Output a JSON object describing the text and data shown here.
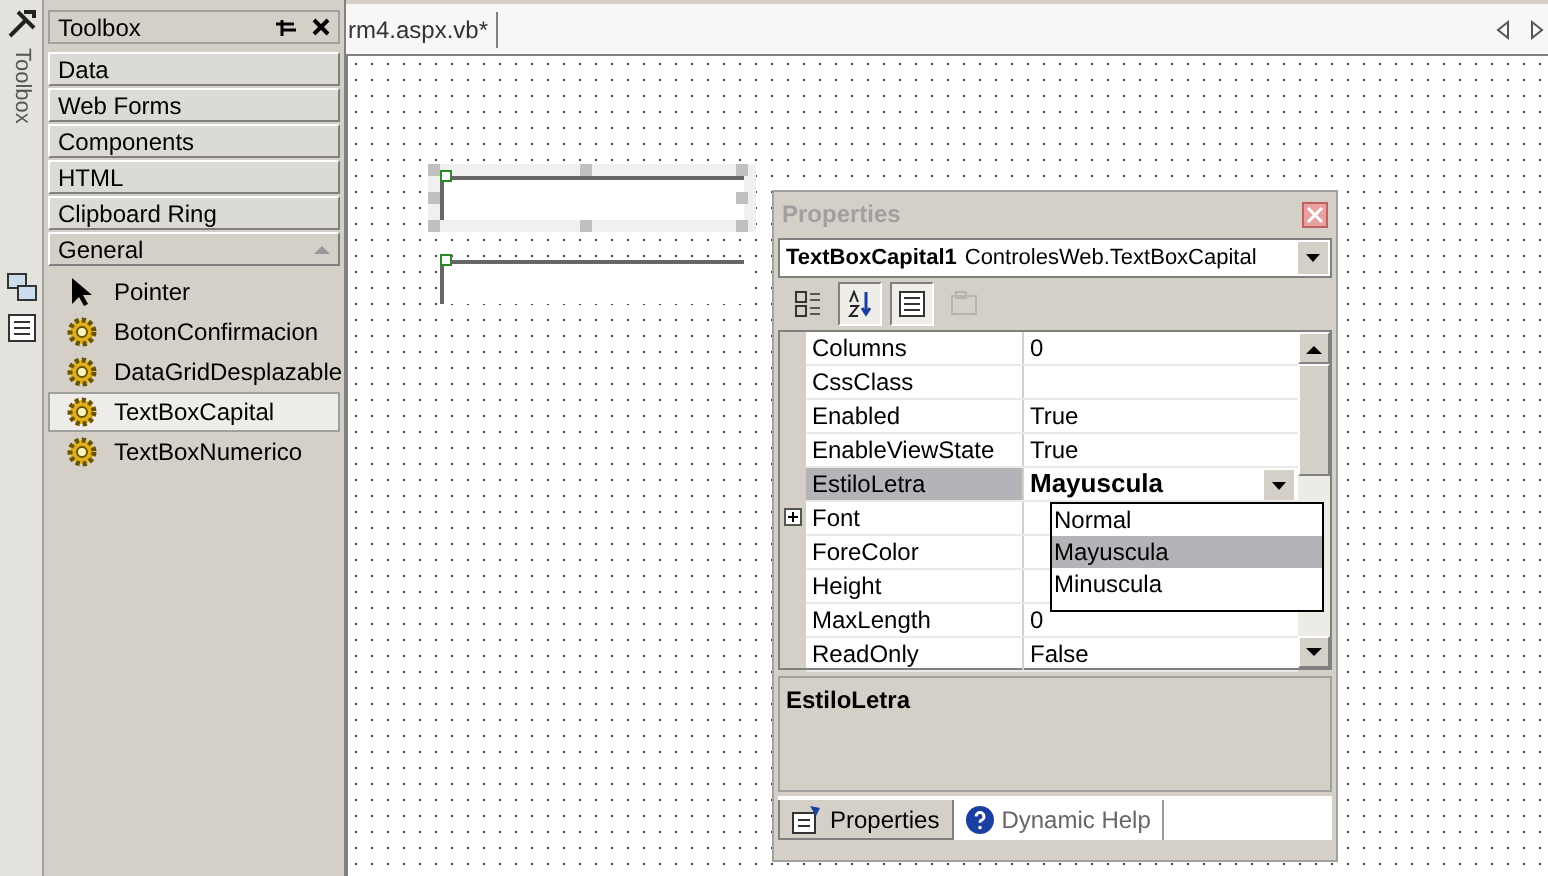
{
  "toolbox": {
    "side_tab": "Toolbox",
    "title": "Toolbox",
    "categories": [
      {
        "label": "Data",
        "expanded": false
      },
      {
        "label": "Web Forms",
        "expanded": false
      },
      {
        "label": "Components",
        "expanded": false
      },
      {
        "label": "HTML",
        "expanded": false
      },
      {
        "label": "Clipboard Ring",
        "expanded": false
      },
      {
        "label": "General",
        "expanded": true
      }
    ],
    "items": [
      {
        "label": "Pointer",
        "kind": "pointer",
        "selected": false
      },
      {
        "label": "BotonConfirmacion",
        "kind": "component",
        "selected": false
      },
      {
        "label": "DataGridDesplazable",
        "kind": "component",
        "selected": false
      },
      {
        "label": "TextBoxCapital",
        "kind": "component",
        "selected": true
      },
      {
        "label": "TextBoxNumerico",
        "kind": "component",
        "selected": false
      }
    ]
  },
  "document_tab": {
    "title": "rm4.aspx.vb*"
  },
  "designer": {
    "textboxes": [
      {
        "selected": true
      },
      {
        "selected": false
      }
    ]
  },
  "properties": {
    "title": "Properties",
    "object_name": "TextBoxCapital1",
    "object_type": "ControlesWeb.TextBoxCapital",
    "toolbar": [
      {
        "kind": "categorized",
        "pressed": false,
        "disabled": false
      },
      {
        "kind": "alphabetical",
        "pressed": true,
        "disabled": false
      },
      {
        "kind": "properties",
        "pressed": true,
        "disabled": false
      },
      {
        "kind": "pages",
        "pressed": false,
        "disabled": true
      }
    ],
    "rows": [
      {
        "name": "Columns",
        "value": "0",
        "selected": false,
        "expandable": false
      },
      {
        "name": "CssClass",
        "selected": false,
        "expandable": false
      },
      {
        "name": "Enabled",
        "value": "True",
        "selected": false,
        "expandable": false
      },
      {
        "name": "EnableViewState",
        "value": "True",
        "selected": false,
        "expandable": false
      },
      {
        "name": "EstiloLetra",
        "value": "Mayuscula",
        "selected": true,
        "expandable": false
      },
      {
        "name": "Font",
        "selected": false,
        "expandable": true
      },
      {
        "name": "ForeColor",
        "selected": false,
        "expandable": false
      },
      {
        "name": "Height",
        "selected": false,
        "expandable": false
      },
      {
        "name": "MaxLength",
        "value": "0",
        "selected": false,
        "expandable": false
      },
      {
        "name": "ReadOnly",
        "value": "False",
        "selected": false,
        "expandable": false
      }
    ],
    "dropdown_options": [
      {
        "label": "Normal",
        "selected": false
      },
      {
        "label": "Mayuscula",
        "selected": true
      },
      {
        "label": "Minuscula",
        "selected": false
      }
    ],
    "description": {
      "title": "EstiloLetra"
    },
    "tabs": [
      {
        "label": "Properties",
        "kind": "properties",
        "selected": true
      },
      {
        "label": "Dynamic Help",
        "kind": "help",
        "selected": false
      }
    ]
  }
}
